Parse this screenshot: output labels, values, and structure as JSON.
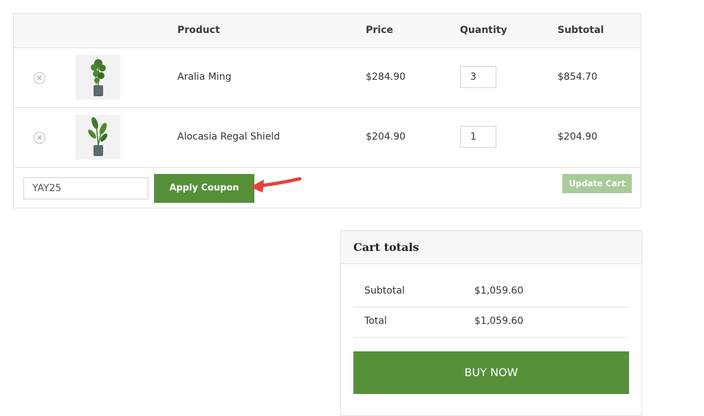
{
  "cart": {
    "headers": {
      "product": "Product",
      "price": "Price",
      "quantity": "Quantity",
      "subtotal": "Subtotal"
    },
    "items": [
      {
        "remove_icon": "remove-circle-icon",
        "name": "Aralia Ming",
        "price": "$284.90",
        "quantity": "3",
        "subtotal": "$854.70"
      },
      {
        "remove_icon": "remove-circle-icon",
        "name": "Alocasia Regal Shield",
        "price": "$204.90",
        "quantity": "1",
        "subtotal": "$204.90"
      }
    ],
    "coupon_value": "YAY25",
    "apply_coupon_label": "Apply Coupon",
    "update_cart_label": "Update Cart"
  },
  "totals": {
    "title": "Cart totals",
    "rows": [
      {
        "label": "Subtotal",
        "value": "$1,059.60"
      },
      {
        "label": "Total",
        "value": "$1,059.60"
      }
    ],
    "buy_label": "BUY NOW"
  },
  "colors": {
    "accent_green": "#56913a",
    "disabled_green": "#a9cb99",
    "annotation_arrow": "#e8413c"
  }
}
